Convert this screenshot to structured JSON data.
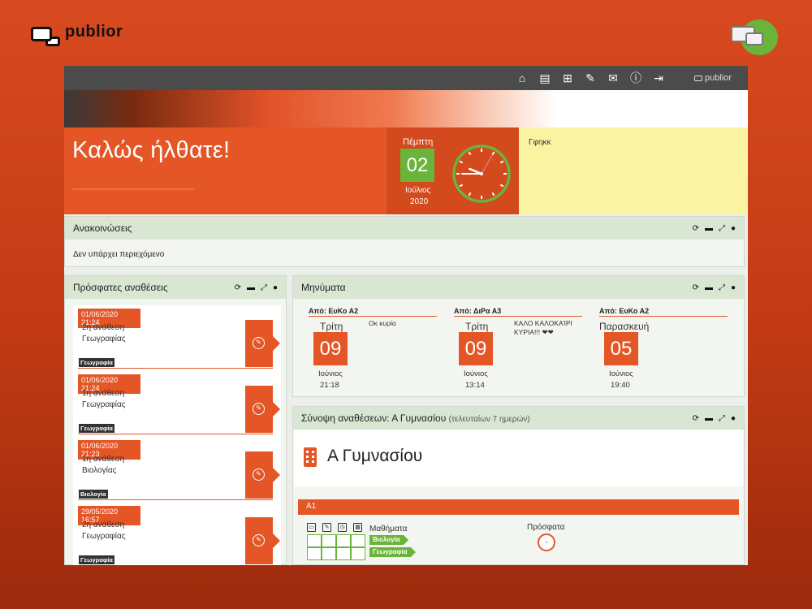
{
  "brand": {
    "name": "publior"
  },
  "topbar": {
    "brand": "publior"
  },
  "welcome": {
    "title": "Καλώς ήλθατε!"
  },
  "date": {
    "day_name": "Πέμπτη",
    "day": "02",
    "month": "Ιούλιος",
    "year": "2020"
  },
  "clock": {
    "hour": 9,
    "minute": 45,
    "second": 5
  },
  "note": {
    "text": "Γφηκκ"
  },
  "announcements": {
    "title": "Ανακοινώσεις",
    "empty": "Δεν υπάρχει περιεχόμενο"
  },
  "recent": {
    "title": "Πρόσφατες αναθέσεις",
    "items": [
      {
        "date": "01/06/2020 21:24",
        "line1": "2η ανάθεση",
        "line2": "Γεωγραφίας",
        "tag": "Γεωγραφία"
      },
      {
        "date": "01/06/2020 21:24",
        "line1": "1η ανάθεση",
        "line2": "Γεωγραφίας",
        "tag": "Γεωγραφία"
      },
      {
        "date": "01/06/2020 21:23",
        "line1": "1η ανάθεση",
        "line2": "Βιολογίας",
        "tag": "Βιολογία"
      },
      {
        "date": "29/05/2020 16:57",
        "line1": "2η ανάθεση",
        "line2": "Γεωγραφίας",
        "tag": "Γεωγραφία"
      }
    ]
  },
  "messages": {
    "title": "Μηνύματα",
    "items": [
      {
        "from": "Από: ΕυΚο Α2",
        "weekday": "Τρίτη",
        "day": "09",
        "month": "Ιούνιος",
        "time": "21:18",
        "text": "Οκ κυρία"
      },
      {
        "from": "Από: ΔιΡα Α3",
        "weekday": "Τρίτη",
        "day": "09",
        "month": "Ιούνιος",
        "time": "13:14",
        "text": "ΚΑΛΟ ΚΑΛΟΚΑΊΡΙ ΚΥΡΙΑ!!! ❤❤"
      },
      {
        "from": "Από: ΕυΚο Α2",
        "weekday": "Παρασκευή",
        "day": "05",
        "month": "Ιούνιος",
        "time": "19:40",
        "text": ""
      }
    ]
  },
  "summary": {
    "title": "Σύνοψη αναθέσεων: Α Γυμνασίου",
    "subtitle": "(τελευταίων 7 ημερών)",
    "class_name": "Α Γυμνασίου",
    "section": "Α1",
    "subjects_label": "Μαθήματα",
    "subjects": [
      "Βιολογία",
      "Γεωγραφία"
    ],
    "recent_label": "Πρόσφατα",
    "recent_value": "-"
  },
  "colors": {
    "accent": "#e55627",
    "green": "#6ab43a",
    "note_bg": "#faf3a2",
    "panel_header": "#d8e6d3"
  }
}
